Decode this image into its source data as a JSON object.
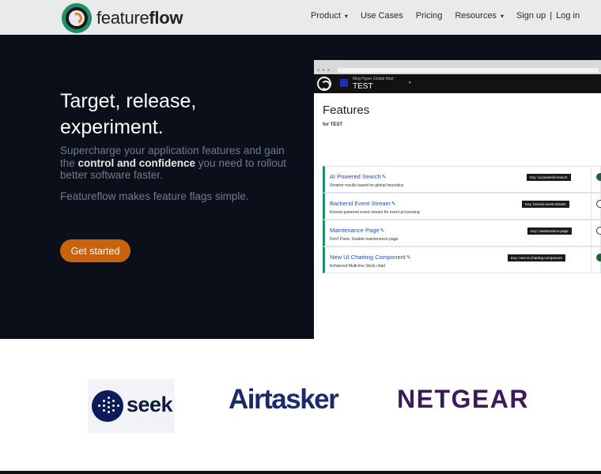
{
  "brand": {
    "name_light": "feature",
    "name_bold": "flow"
  },
  "nav": {
    "items": [
      {
        "label": "Product",
        "dropdown": true
      },
      {
        "label": "Use Cases",
        "dropdown": false
      },
      {
        "label": "Pricing",
        "dropdown": false
      },
      {
        "label": "Resources",
        "dropdown": true
      }
    ],
    "signup": "Sign up",
    "separator": "|",
    "login": "Log in",
    "chevron": "▾"
  },
  "hero": {
    "title": "Target, release, experiment.",
    "sub_pre": "Supercharge your application features and gain the ",
    "sub_bold": "control and confidence",
    "sub_post": " you need to rollout better software faster.",
    "sub2": "Featureflow makes feature flags simple.",
    "cta": "Get started"
  },
  "app": {
    "chrome_dots": "● ● ●",
    "org": "Meg Hyper Global Mart",
    "env": "TEST",
    "dropdown": "▾",
    "page_title": "Features",
    "for_env": "for TEST",
    "edit_icon": "✎",
    "features": [
      {
        "name": "AI Powered Search",
        "desc": "Smarter results based on global heuristics.",
        "key": "Key: ai-powered-search",
        "state": "on"
      },
      {
        "name": "Backend Event Stream",
        "desc": "Kinesis-powered event stream for event processing",
        "key": "Key: kinesis-event-stream",
        "state": "off"
      },
      {
        "name": "Maintenance Page",
        "desc": "Don't Panic. Enable maintenance page.",
        "key": "Key: maintenance-page",
        "state": "off"
      },
      {
        "name": "New UI Charting Component",
        "desc": "Enhanced Multi-line Stock chart",
        "key": "Key: new-ui-charting-component",
        "state": "on"
      }
    ]
  },
  "clients": {
    "seek": "seek",
    "airtasker": "Airtasker",
    "netgear": "NETGEAR"
  },
  "colors": {
    "accent": "#c8620f",
    "brand_green": "#1f8f6a",
    "hero_bg": "#0b0f19",
    "nav_bg": "#e9eaeb"
  }
}
